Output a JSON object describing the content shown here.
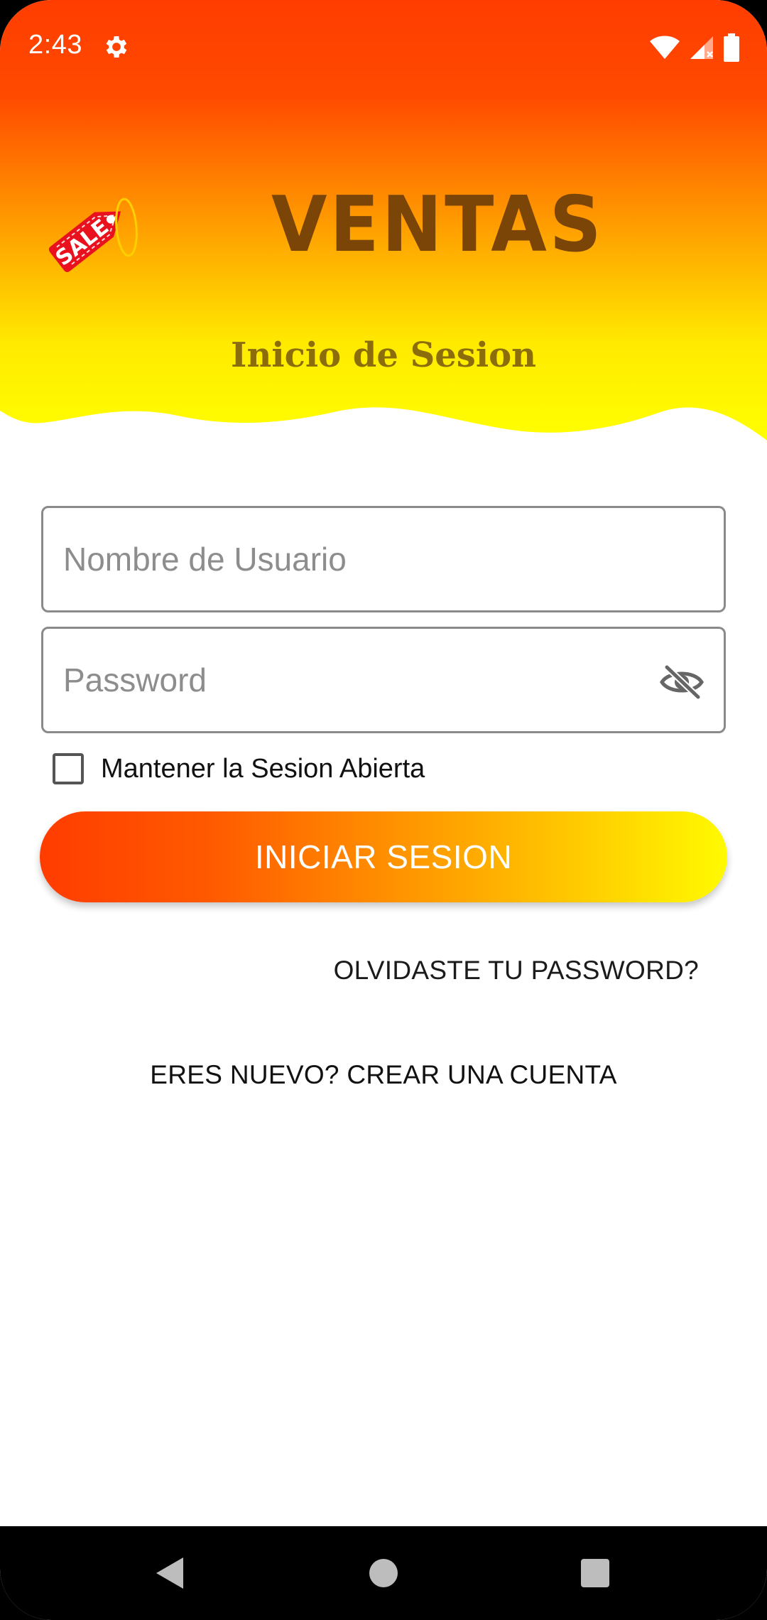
{
  "status_bar": {
    "time": "2:43",
    "icons": [
      "gear-icon",
      "wifi-icon",
      "signal-icon",
      "battery-icon"
    ]
  },
  "header": {
    "logo_text": "SALE",
    "app_title": "VENTAS",
    "subtitle": "Inicio de Sesion",
    "gradient_colors": [
      "#ff3d00",
      "#ff8c00",
      "#ffff00"
    ]
  },
  "form": {
    "username_placeholder": "Nombre de Usuario",
    "username_value": "",
    "password_placeholder": "Password",
    "password_value": "",
    "password_toggle_icon": "eye-off-icon",
    "remember_label": "Mantener la Sesion Abierta",
    "remember_checked": false,
    "login_button": "INICIAR SESION",
    "forgot_link": "OLVIDASTE TU PASSWORD?",
    "create_link": "ERES NUEVO? CREAR UNA CUENTA"
  },
  "nav_bar": {
    "icons": [
      "back-icon",
      "home-icon",
      "recents-icon"
    ]
  },
  "colors": {
    "title": "#7a4507",
    "subtitle": "#8c6d0c",
    "button_gradient_start": "#ff3c00",
    "button_gradient_end": "#fffa00"
  }
}
